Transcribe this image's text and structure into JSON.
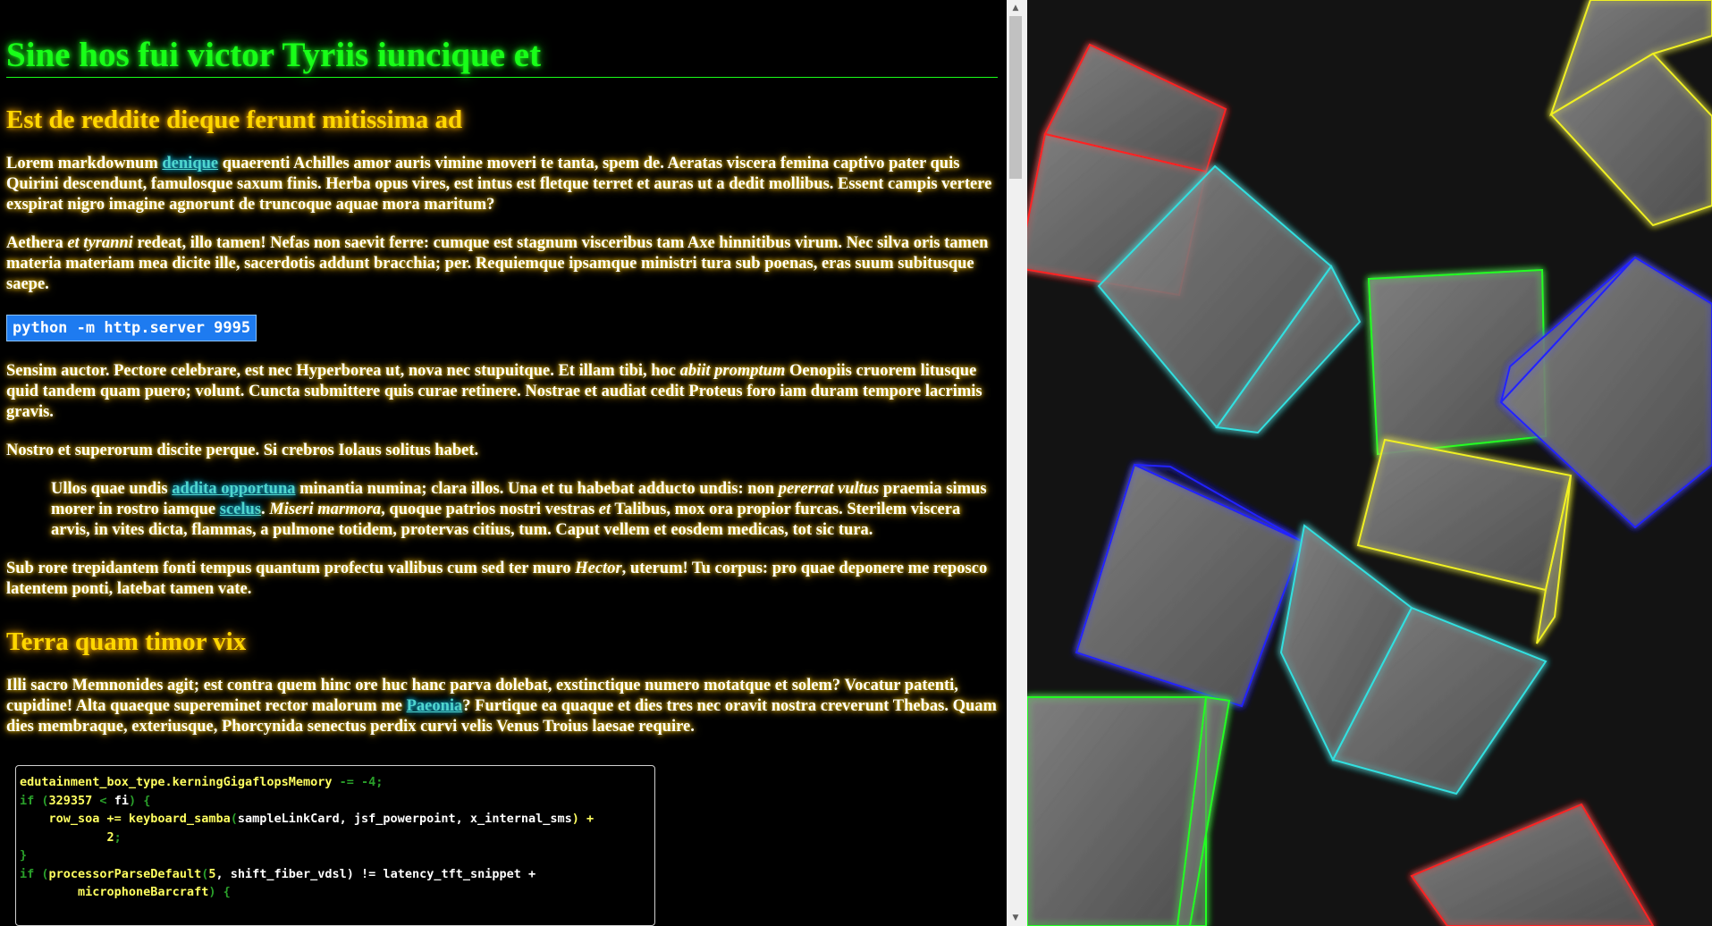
{
  "article": {
    "h1": "Sine hos fui victor Tyriis iuncique et",
    "h2_first": "Est de reddite dieque ferunt mitissima ad",
    "p1": {
      "a": "Lorem markdownum ",
      "link": "denique",
      "b": " quaerenti Achilles amor auris vimine moveri te tanta, spem de. Aeratas viscera femina captivo pater quis Quirini descendunt, famulosque saxum finis. Herba opus vires, est intus est fletque terret et auras ut a dedit mollibus. Essent campis vertere exspirat nigro imagine agnorunt de truncoque aquae mora maritum?"
    },
    "p2": {
      "a": "Aethera ",
      "em": "et tyranni",
      "b": " redeat, illo tamen! Nefas non saevit ferre: cumque est stagnum visceribus tam Axe hinnitibus virum. Nec silva oris tamen materia materiam mea dicite ille, sacerdotis addunt bracchia; per. Requiemque ipsamque ministri tura sub poenas, eras suum subitusque saepe."
    },
    "command": "python -m http.server 9995",
    "p3": {
      "a": "Sensim auctor. Pectore celebrare, est nec Hyperborea ut, nova nec stupuitque. Et illam tibi, hoc ",
      "em": "abiit promptum",
      "b": " Oenopiis cruorem litusque quid tandem quam puero; volunt. Cuncta submittere quis curae retinere. Nostrae et audiat cedit Proteus foro iam duram tempore lacrimis gravis."
    },
    "p4": "Nostro et superorum discite perque. Si crebros Iolaus solitus habet.",
    "quote": {
      "a": "Ullos quae undis ",
      "link1": "addita opportuna",
      "b": " minantia numina; clara illos. Una et tu habebat adducto undis: non ",
      "em1": "pererrat vultus",
      "c": " praemia simus morer in rostro iamque ",
      "link2": "scelus",
      "d": ". ",
      "em2": "Miseri marmora",
      "e": ", quoque patrios nostri vestras ",
      "em3": "et",
      "f": " Talibus, mox ora propior furcas. Sterilem viscera arvis, in vites dicta, flammas, a pulmone totidem, protervas citius, tum. Caput vellem et eosdem medicas, tot sic tura."
    },
    "p5": {
      "a": "Sub rore trepidantem fonti tempus quantum profectu vallibus cum sed ter muro ",
      "em": "Hector",
      "b": ", uterum! Tu corpus: pro quae deponere me reposco latentem ponti, latebat tamen vate."
    },
    "h2_second": "Terra quam timor vix",
    "p6": {
      "a": "Illi sacro Memnonides agit; est contra quem hinc ore huc hanc parva dolebat, exstinctique numero motatque et solem? Vocatur patenti, cupidine! Alta quaeque supereminet rector malorum me ",
      "link": "Paeonia",
      "b": "? Furtique ea quaque et dies tres nec oravit nostra creverunt Thebas. Quam dies membraque, exteriusque, Phorcynida senectus perdix curvi velis Venus Troius laesae require."
    }
  },
  "code": {
    "l1_a": "edutainment_box_type.kerningGigaflopsMemory",
    "l1_b": " -= ",
    "l1_c": "-4",
    "l1_d": ";",
    "l2_a": "if (",
    "l2_b": "329357",
    "l2_c": " < ",
    "l2_d": "fi",
    "l2_e": ") {",
    "l3_a": "    row_soa += keyboard_samba",
    "l3_b": "(",
    "l3_c": "sampleLinkCard, jsf_powerpoint, x_internal_sms",
    "l3_d": ") +",
    "l4_a": "            2",
    "l4_b": ";",
    "l5": "}",
    "l6_a": "if (",
    "l6_b": "processorParseDefault",
    "l6_c": "(",
    "l6_d": "5",
    "l6_e": ", shift_fiber_vdsl",
    "l6_f": ") != latency_tft_snippet +",
    "l7_a": "        microphoneBarcraft",
    "l7_b": ") {"
  },
  "colors": {
    "heading1": "#19ff19",
    "heading2": "#ffd700",
    "link": "#4fd6cf",
    "command_bg": "#1e7bf0",
    "cube_red": "#ff2020",
    "cube_cyan": "#30e0e0",
    "cube_green": "#20ff20",
    "cube_blue": "#2020ff",
    "cube_yellow": "#f0f020"
  },
  "icons": {
    "scroll_up": "scroll-up-arrow-icon",
    "scroll_down": "scroll-down-arrow-icon"
  }
}
